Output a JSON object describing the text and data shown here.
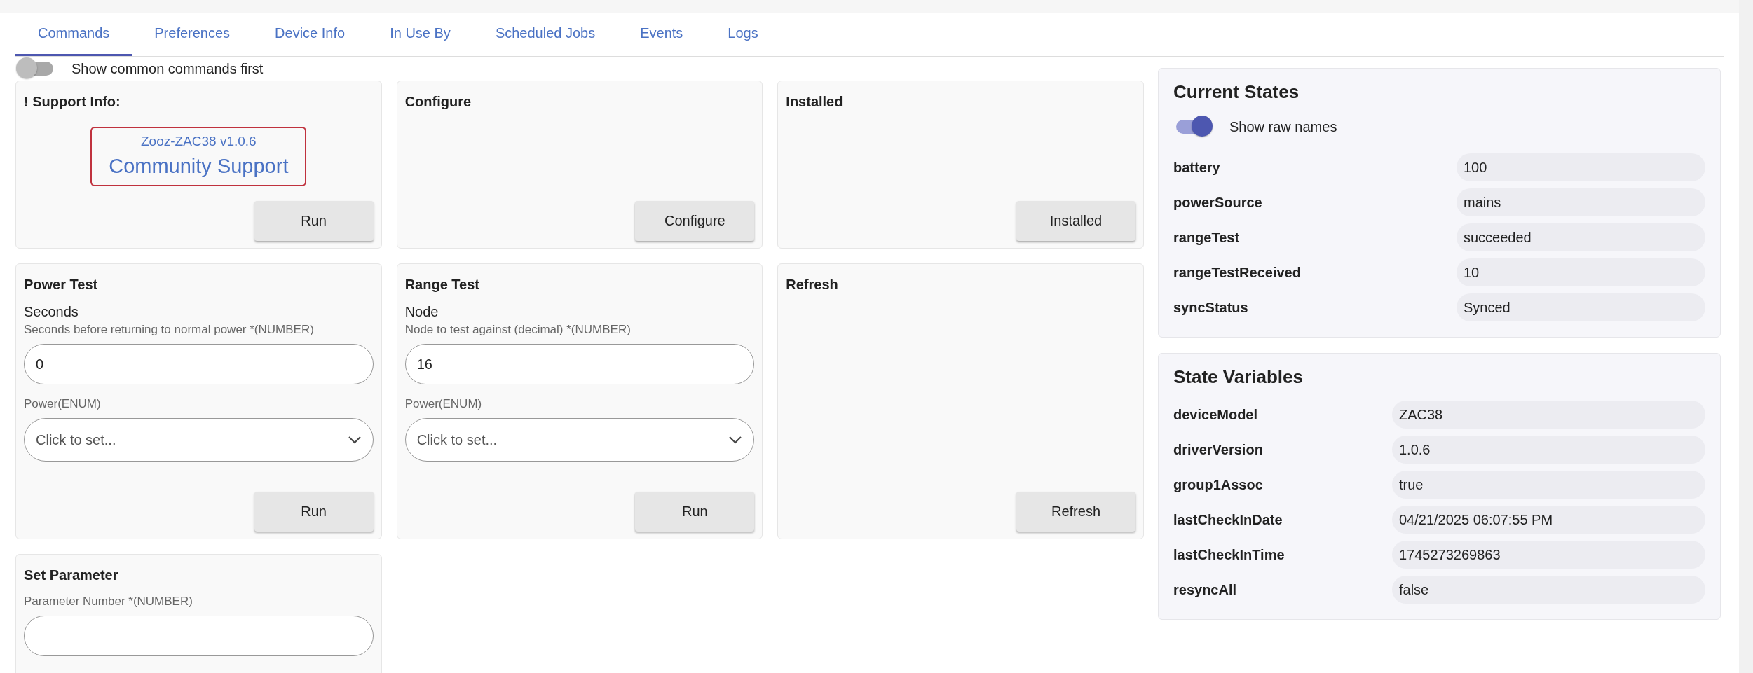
{
  "tabs": [
    {
      "label": "Commands",
      "selected": true
    },
    {
      "label": "Preferences",
      "selected": false
    },
    {
      "label": "Device Info",
      "selected": false
    },
    {
      "label": "In Use By",
      "selected": false
    },
    {
      "label": "Scheduled Jobs",
      "selected": false
    },
    {
      "label": "Events",
      "selected": false
    },
    {
      "label": "Logs",
      "selected": false
    }
  ],
  "common_toggle": {
    "label": "Show common commands first",
    "on": false
  },
  "commands": [
    {
      "title": "! Support Info:",
      "support": {
        "version": "Zooz-ZAC38 v1.0.6",
        "link": "Community Support"
      },
      "button": "Run"
    },
    {
      "title": "Configure",
      "button": "Configure"
    },
    {
      "title": "Installed",
      "button": "Installed"
    },
    {
      "title": "Power Test",
      "params": [
        {
          "kind": "number",
          "name": "Seconds",
          "description": "Seconds before returning to normal power *(NUMBER)",
          "value": "0"
        },
        {
          "kind": "enum",
          "description": "Power(ENUM)",
          "placeholder": "Click to set..."
        }
      ],
      "button": "Run"
    },
    {
      "title": "Range Test",
      "params": [
        {
          "kind": "number",
          "name": "Node",
          "description": "Node to test against (decimal) *(NUMBER)",
          "value": "16"
        },
        {
          "kind": "enum",
          "description": "Power(ENUM)",
          "placeholder": "Click to set..."
        }
      ],
      "button": "Run"
    },
    {
      "title": "Refresh",
      "button": "Refresh"
    },
    {
      "title": "Set Parameter",
      "params": [
        {
          "kind": "number",
          "description": "Parameter Number *(NUMBER)"
        }
      ]
    }
  ],
  "current_states": {
    "title": "Current States",
    "raw_toggle": {
      "label": "Show raw names",
      "on": true
    },
    "rows": [
      {
        "name": "battery",
        "value": "100"
      },
      {
        "name": "powerSource",
        "value": "mains"
      },
      {
        "name": "rangeTest",
        "value": "succeeded"
      },
      {
        "name": "rangeTestReceived",
        "value": "10"
      },
      {
        "name": "syncStatus",
        "value": "Synced"
      }
    ]
  },
  "state_variables": {
    "title": "State Variables",
    "rows": [
      {
        "name": "deviceModel",
        "value": "ZAC38"
      },
      {
        "name": "driverVersion",
        "value": "1.0.6"
      },
      {
        "name": "group1Assoc",
        "value": "true"
      },
      {
        "name": "lastCheckInDate",
        "value": "04/21/2025 06:07:55 PM"
      },
      {
        "name": "lastCheckInTime",
        "value": "1745273269863"
      },
      {
        "name": "resyncAll",
        "value": "false"
      }
    ]
  }
}
